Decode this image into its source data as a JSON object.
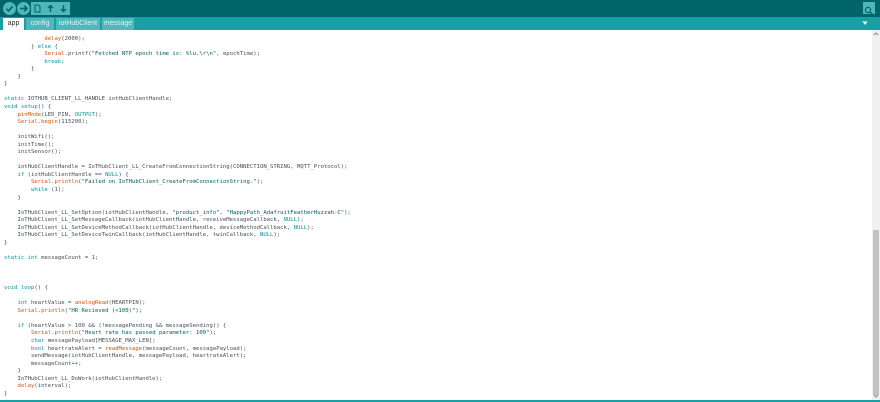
{
  "toolbar": {
    "buttons": [
      {
        "name": "verify-button",
        "icon": "checkmark-icon"
      },
      {
        "name": "upload-button",
        "icon": "arrow-right-icon"
      },
      {
        "name": "new-button",
        "icon": "new-file-icon"
      },
      {
        "name": "open-button",
        "icon": "arrow-up-icon"
      },
      {
        "name": "save-button",
        "icon": "arrow-down-icon"
      }
    ],
    "serial_monitor_icon": "magnifier-icon",
    "colors": {
      "bar": "#006468",
      "button": "#4db7bb"
    }
  },
  "tabs": [
    {
      "label": "app",
      "active": true
    },
    {
      "label": "config",
      "active": false
    },
    {
      "label": "iotHubClient",
      "active": false
    },
    {
      "label": "message",
      "active": false
    }
  ],
  "code": [
    [
      {
        "t": "            ",
        "c": "plain"
      },
      {
        "t": "delay",
        "c": "fn"
      },
      {
        "t": "(2000);",
        "c": "plain"
      }
    ],
    [
      {
        "t": "        } ",
        "c": "plain"
      },
      {
        "t": "else",
        "c": "kw"
      },
      {
        "t": " {",
        "c": "plain"
      }
    ],
    [
      {
        "t": "            ",
        "c": "plain"
      },
      {
        "t": "Serial",
        "c": "fn"
      },
      {
        "t": ".printf(",
        "c": "plain"
      },
      {
        "t": "\"Fetched NTP epoch time is: %lu.\\r\\n\"",
        "c": "str"
      },
      {
        "t": ", epochTime);",
        "c": "plain"
      }
    ],
    [
      {
        "t": "            ",
        "c": "plain"
      },
      {
        "t": "break",
        "c": "kw"
      },
      {
        "t": ";",
        "c": "plain"
      }
    ],
    [
      {
        "t": "        }",
        "c": "plain"
      }
    ],
    [
      {
        "t": "    }",
        "c": "plain"
      }
    ],
    [
      {
        "t": "}",
        "c": "plain"
      }
    ],
    [],
    [
      {
        "t": "static",
        "c": "kw"
      },
      {
        "t": " IOTHUB_CLIENT_LL_HANDLE iotHubClientHandle;",
        "c": "plain"
      }
    ],
    [
      {
        "t": "void",
        "c": "kw"
      },
      {
        "t": " ",
        "c": "plain"
      },
      {
        "t": "setup",
        "c": "kw"
      },
      {
        "t": "() {",
        "c": "plain"
      }
    ],
    [
      {
        "t": "    ",
        "c": "plain"
      },
      {
        "t": "pinMode",
        "c": "fn"
      },
      {
        "t": "(LED_PIN, ",
        "c": "plain"
      },
      {
        "t": "OUTPUT",
        "c": "kw"
      },
      {
        "t": ");",
        "c": "plain"
      }
    ],
    [
      {
        "t": "    ",
        "c": "plain"
      },
      {
        "t": "Serial",
        "c": "fn"
      },
      {
        "t": ".",
        "c": "plain"
      },
      {
        "t": "begin",
        "c": "fn"
      },
      {
        "t": "(115200);",
        "c": "plain"
      }
    ],
    [],
    [
      {
        "t": "    initWifi();",
        "c": "plain"
      }
    ],
    [
      {
        "t": "    initTime();",
        "c": "plain"
      }
    ],
    [
      {
        "t": "    initSensor();",
        "c": "plain"
      }
    ],
    [],
    [
      {
        "t": "    iotHubClientHandle = IoTHubClient_LL_CreateFromConnectionString(CONNECTION_STRING, MQTT_Protocol);",
        "c": "plain"
      }
    ],
    [
      {
        "t": "    ",
        "c": "plain"
      },
      {
        "t": "if",
        "c": "kw"
      },
      {
        "t": " (iotHubClientHandle == ",
        "c": "plain"
      },
      {
        "t": "NULL",
        "c": "kw"
      },
      {
        "t": ") {",
        "c": "plain"
      }
    ],
    [
      {
        "t": "        ",
        "c": "plain"
      },
      {
        "t": "Serial",
        "c": "fn"
      },
      {
        "t": ".",
        "c": "plain"
      },
      {
        "t": "println",
        "c": "fn"
      },
      {
        "t": "(",
        "c": "plain"
      },
      {
        "t": "\"Failed on IoTHubClient_CreateFromConnectionString.\"",
        "c": "str"
      },
      {
        "t": ");",
        "c": "plain"
      }
    ],
    [
      {
        "t": "        ",
        "c": "plain"
      },
      {
        "t": "while",
        "c": "kw"
      },
      {
        "t": " (1);",
        "c": "plain"
      }
    ],
    [
      {
        "t": "    }",
        "c": "plain"
      }
    ],
    [],
    [
      {
        "t": "    IoTHubClient_LL_SetOption(iotHubClientHandle, ",
        "c": "plain"
      },
      {
        "t": "\"product_info\"",
        "c": "str"
      },
      {
        "t": ", ",
        "c": "plain"
      },
      {
        "t": "\"HappyPath_AdafruitFeatherHuzzah-C\"",
        "c": "str"
      },
      {
        "t": ");",
        "c": "plain"
      }
    ],
    [
      {
        "t": "    IoTHubClient_LL_SetMessageCallback(iotHubClientHandle, receiveMessageCallback, ",
        "c": "plain"
      },
      {
        "t": "NULL",
        "c": "kw"
      },
      {
        "t": ");",
        "c": "plain"
      }
    ],
    [
      {
        "t": "    IoTHubClient_LL_SetDeviceMethodCallback(iotHubClientHandle, deviceMethodCallback, ",
        "c": "plain"
      },
      {
        "t": "NULL",
        "c": "kw"
      },
      {
        "t": ");",
        "c": "plain"
      }
    ],
    [
      {
        "t": "    IoTHubClient_LL_SetDeviceTwinCallback(iotHubClientHandle, twinCallback, ",
        "c": "plain"
      },
      {
        "t": "NULL",
        "c": "kw"
      },
      {
        "t": ");",
        "c": "plain"
      }
    ],
    [
      {
        "t": "}",
        "c": "plain"
      }
    ],
    [],
    [
      {
        "t": "static",
        "c": "kw"
      },
      {
        "t": " ",
        "c": "plain"
      },
      {
        "t": "int",
        "c": "kw"
      },
      {
        "t": " messageCount = 1;",
        "c": "plain"
      }
    ],
    [],
    [],
    [],
    [
      {
        "t": "void",
        "c": "kw"
      },
      {
        "t": " ",
        "c": "plain"
      },
      {
        "t": "loop",
        "c": "kw"
      },
      {
        "t": "() {",
        "c": "plain"
      }
    ],
    [],
    [
      {
        "t": "    ",
        "c": "plain"
      },
      {
        "t": "int",
        "c": "kw"
      },
      {
        "t": " heartValue = ",
        "c": "plain"
      },
      {
        "t": "analogRead",
        "c": "fn"
      },
      {
        "t": "(HEARTPIN);",
        "c": "plain"
      }
    ],
    [
      {
        "t": "    ",
        "c": "plain"
      },
      {
        "t": "Serial",
        "c": "fn"
      },
      {
        "t": ".",
        "c": "plain"
      },
      {
        "t": "println",
        "c": "fn"
      },
      {
        "t": "(",
        "c": "plain"
      },
      {
        "t": "\"HR Recieved (<100)\"",
        "c": "str"
      },
      {
        "t": ");",
        "c": "plain"
      }
    ],
    [],
    [
      {
        "t": "    ",
        "c": "plain"
      },
      {
        "t": "if",
        "c": "kw"
      },
      {
        "t": " (heartValue > 100 && (!messagePending && messageSending)) {",
        "c": "plain"
      }
    ],
    [
      {
        "t": "        ",
        "c": "plain"
      },
      {
        "t": "Serial",
        "c": "fn"
      },
      {
        "t": ".",
        "c": "plain"
      },
      {
        "t": "println",
        "c": "fn"
      },
      {
        "t": "(",
        "c": "plain"
      },
      {
        "t": "\"Heart rate has passed parameter: 100\"",
        "c": "str"
      },
      {
        "t": ");",
        "c": "plain"
      }
    ],
    [
      {
        "t": "        ",
        "c": "plain"
      },
      {
        "t": "char",
        "c": "kw"
      },
      {
        "t": " messagePayload[MESSAGE_MAX_LEN];",
        "c": "plain"
      }
    ],
    [
      {
        "t": "        ",
        "c": "plain"
      },
      {
        "t": "bool",
        "c": "kw"
      },
      {
        "t": " heartrateAlert = ",
        "c": "plain"
      },
      {
        "t": "readMessage",
        "c": "fn"
      },
      {
        "t": "(messageCount, messagePayload);",
        "c": "plain"
      }
    ],
    [
      {
        "t": "        sendMessage(iotHubClientHandle, messagePayload, heartrateAlert);",
        "c": "plain"
      }
    ],
    [
      {
        "t": "        messageCount++;",
        "c": "plain"
      }
    ],
    [
      {
        "t": "    }",
        "c": "plain"
      }
    ],
    [
      {
        "t": "    IoTHubClient_LL_DoWork(iotHubClientHandle);",
        "c": "plain"
      }
    ],
    [
      {
        "t": "    ",
        "c": "plain"
      },
      {
        "t": "delay",
        "c": "fn"
      },
      {
        "t": "(interval);",
        "c": "plain"
      }
    ],
    [
      {
        "t": "}",
        "c": "plain"
      }
    ]
  ]
}
